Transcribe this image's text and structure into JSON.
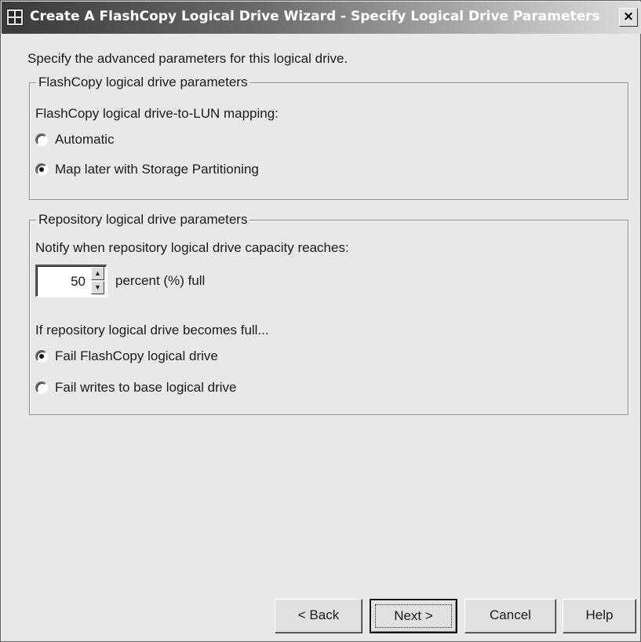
{
  "window": {
    "title": "Create A FlashCopy Logical Drive Wizard - Specify Logical Drive Parameters",
    "close_glyph": "×"
  },
  "intro": "Specify the advanced parameters for this logical drive.",
  "mapping_group": {
    "legend": "FlashCopy logical drive parameters",
    "prompt": "FlashCopy logical drive-to-LUN mapping:",
    "options": [
      {
        "label": "Automatic",
        "checked": false
      },
      {
        "label": "Map later with Storage Partitioning",
        "checked": true
      }
    ]
  },
  "repository_group": {
    "legend": "Repository logical drive parameters",
    "notify_prompt": "Notify when repository logical drive capacity reaches:",
    "threshold_value": "50",
    "threshold_unit": "percent (%) full",
    "full_prompt": "If repository logical drive becomes full...",
    "options": [
      {
        "label": "Fail FlashCopy logical drive",
        "checked": true
      },
      {
        "label": "Fail writes to base logical drive",
        "checked": false
      }
    ]
  },
  "buttons": {
    "back": "< Back",
    "next": "Next >",
    "cancel": "Cancel",
    "help": "Help"
  },
  "icons": {
    "window": "wizard-window-icon",
    "close": "close-icon",
    "spin_up": "arrow-up-icon",
    "spin_down": "arrow-down-icon"
  }
}
